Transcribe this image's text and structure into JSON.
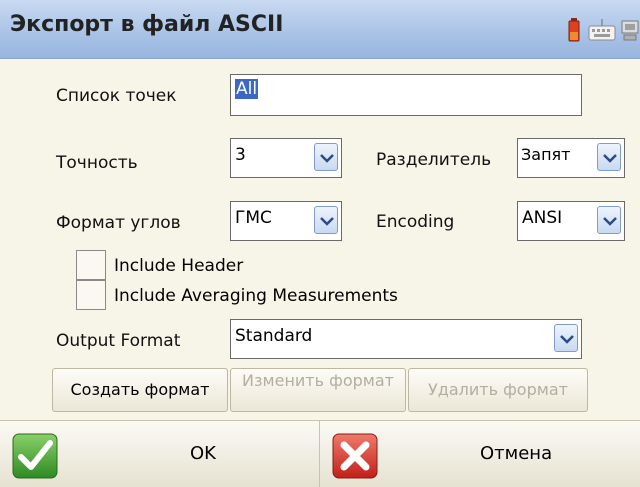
{
  "window": {
    "title": "Экспорт в файл ASCII",
    "tray_icons": [
      "battery-icon",
      "keyboard-icon",
      "connection-icon"
    ]
  },
  "form": {
    "points_list": {
      "label": "Список точек",
      "value": "All"
    },
    "precision": {
      "label": "Точность",
      "value": "3"
    },
    "separator": {
      "label": "Разделитель",
      "value": "Запят"
    },
    "angle_format": {
      "label": "Формат углов",
      "value": "ГМС"
    },
    "encoding": {
      "label": "Encoding",
      "value": "ANSI"
    },
    "include_header": {
      "label": "Include Header",
      "checked": false
    },
    "include_averaging": {
      "label": "Include Averaging Measurements",
      "checked": false
    },
    "output_format": {
      "label": "Output Format",
      "value": "Standard"
    }
  },
  "format_buttons": {
    "create": "Создать формат",
    "edit": "Изменить формат",
    "delete": "Удалить формат"
  },
  "commands": {
    "ok": "OK",
    "cancel": "Отмена"
  },
  "colors": {
    "titlebar": "#a8c2e6",
    "background": "#f7f4e8",
    "selection": "#3a68c4",
    "ok_green": "#3a9a2a",
    "cancel_red": "#d8322a"
  }
}
